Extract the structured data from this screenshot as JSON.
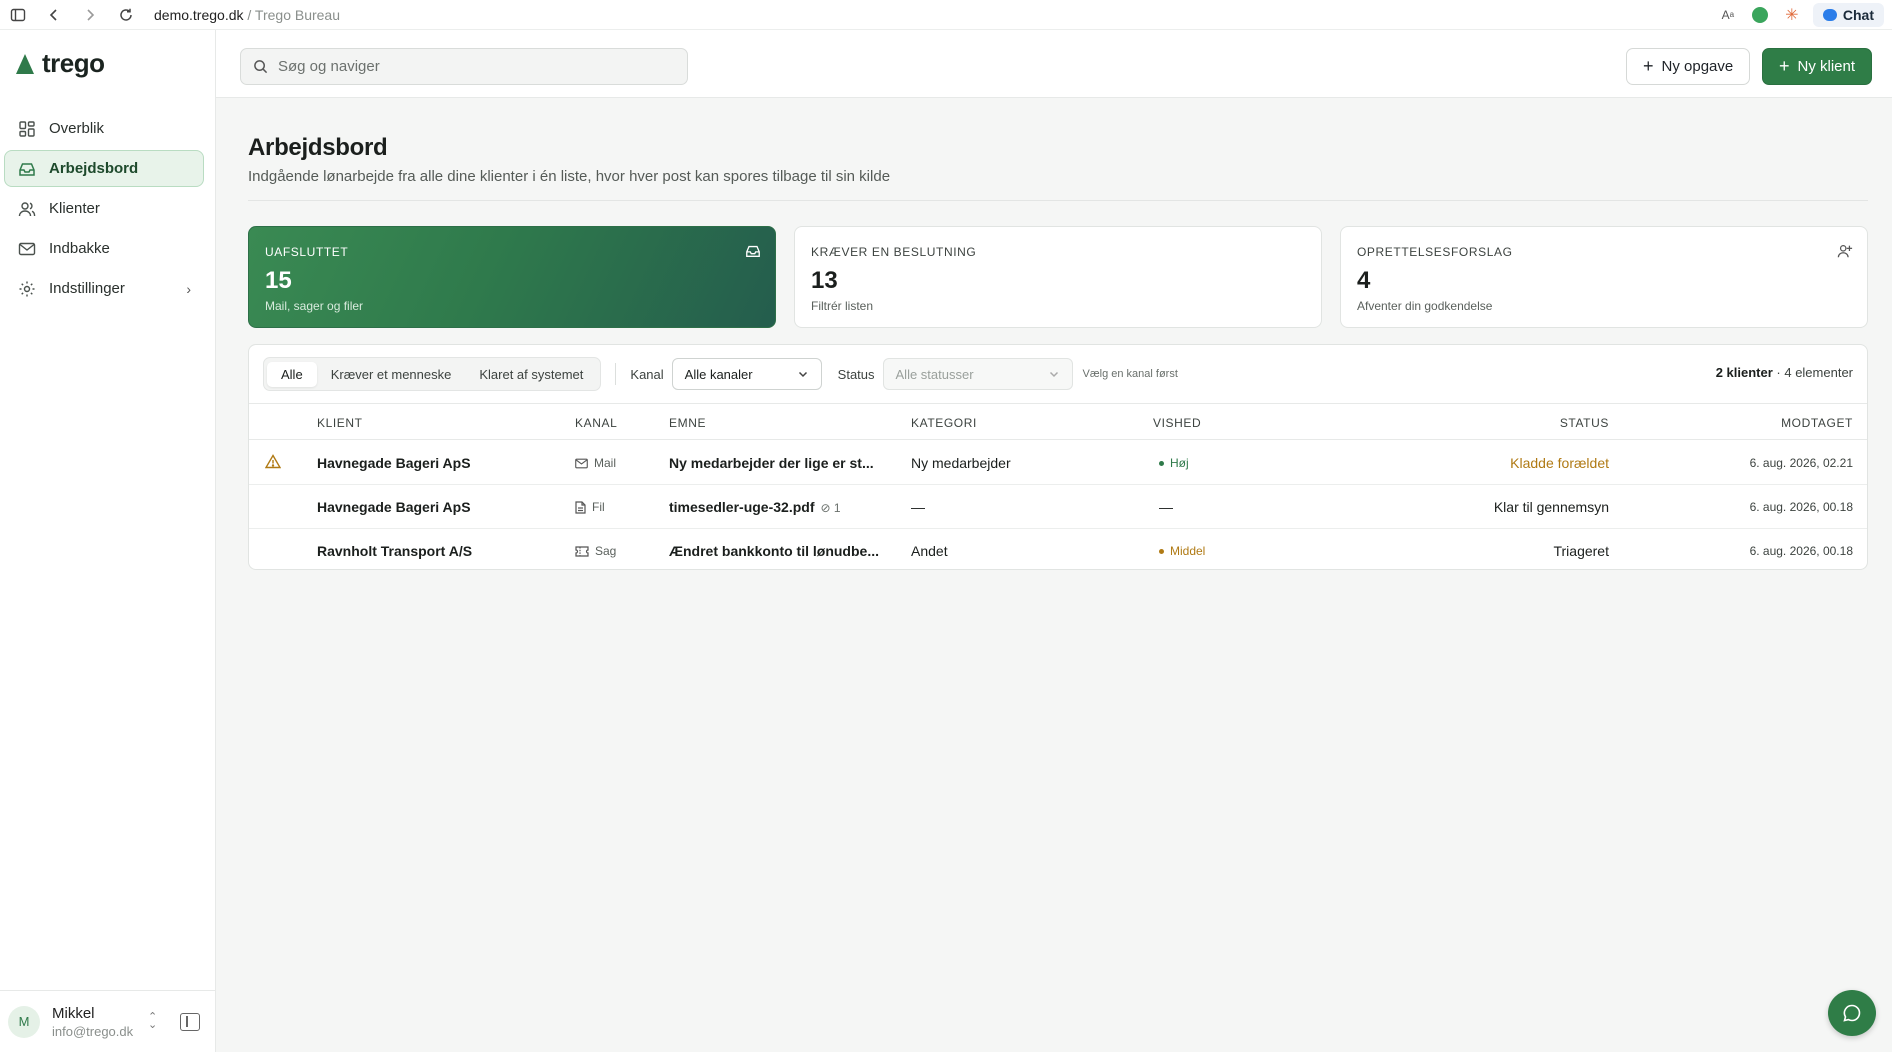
{
  "browser": {
    "host": "demo.trego.dk",
    "separator": "/",
    "page": "Trego Bureau",
    "chat_label": "Chat"
  },
  "sidebar": {
    "logo": "trego",
    "items": [
      {
        "label": "Overblik",
        "icon": "dashboard-icon"
      },
      {
        "label": "Arbejdsbord",
        "icon": "inbox-tray-icon",
        "active": true
      },
      {
        "label": "Klienter",
        "icon": "users-icon"
      },
      {
        "label": "Indbakke",
        "icon": "mail-icon"
      },
      {
        "label": "Indstillinger",
        "icon": "gear-icon"
      }
    ],
    "user": {
      "initial": "M",
      "name": "Mikkel",
      "email": "info@trego.dk"
    }
  },
  "topbar": {
    "search_placeholder": "Søg og naviger",
    "new_task": "Ny opgave",
    "new_client": "Ny klient"
  },
  "main": {
    "title": "Arbejdsbord",
    "subtitle": "Indgående lønarbejde fra alle dine klienter i én liste, hvor hver post kan spores tilbage til sin kilde",
    "cards": [
      {
        "label": "UAFSLUTTET",
        "value": "15",
        "desc": "Mail, sager og filer"
      },
      {
        "label": "KRÆVER EN BESLUTNING",
        "value": "13",
        "desc": "Filtrér listen"
      },
      {
        "label": "OPRETTELSESFORSLAG",
        "value": "4",
        "desc": "Afventer din godkendelse"
      }
    ],
    "filters": {
      "tabs": [
        "Alle",
        "Kræver et menneske",
        "Klaret af systemet"
      ],
      "kanal_label": "Kanal",
      "kanal_value": "Alle kanaler",
      "status_label": "Status",
      "status_value": "Alle statusser",
      "hint": "Vælg en kanal først",
      "counts_bold": "2 klienter",
      "counts_rest": " · 4 elementer"
    },
    "table": {
      "headers": [
        "KLIENT",
        "KANAL",
        "EMNE",
        "KATEGORI",
        "VISHED",
        "STATUS",
        "MODTAGET"
      ],
      "rows": [
        {
          "client": "Havnegade Bageri ApS",
          "kanal": "Mail",
          "emne": "Ny medarbejder der lige er st...",
          "attach": "",
          "kategori": "Ny medarbejder",
          "vished": "Høj",
          "status": "Kladde forældet",
          "modtaget": "6. aug. 2026, 02.21"
        },
        {
          "client": "Havnegade Bageri ApS",
          "kanal": "Fil",
          "emne": "timesedler-uge-32.pdf",
          "attach": "1",
          "kategori": "—",
          "vished": "—",
          "status": "Klar til gennemsyn",
          "modtaget": "6. aug. 2026, 00.18"
        },
        {
          "client": "Ravnholt Transport A/S",
          "kanal": "Sag",
          "emne": "Ændret bankkonto til lønudbe...",
          "attach": "",
          "kategori": "Andet",
          "vished": "Middel",
          "status": "Triageret",
          "modtaget": "6. aug. 2026, 00.18"
        }
      ]
    }
  },
  "colors": {
    "brand": "#2f7d47",
    "warn": "#b07a14",
    "high": "#2f7a4a",
    "medium": "#b07a14"
  }
}
